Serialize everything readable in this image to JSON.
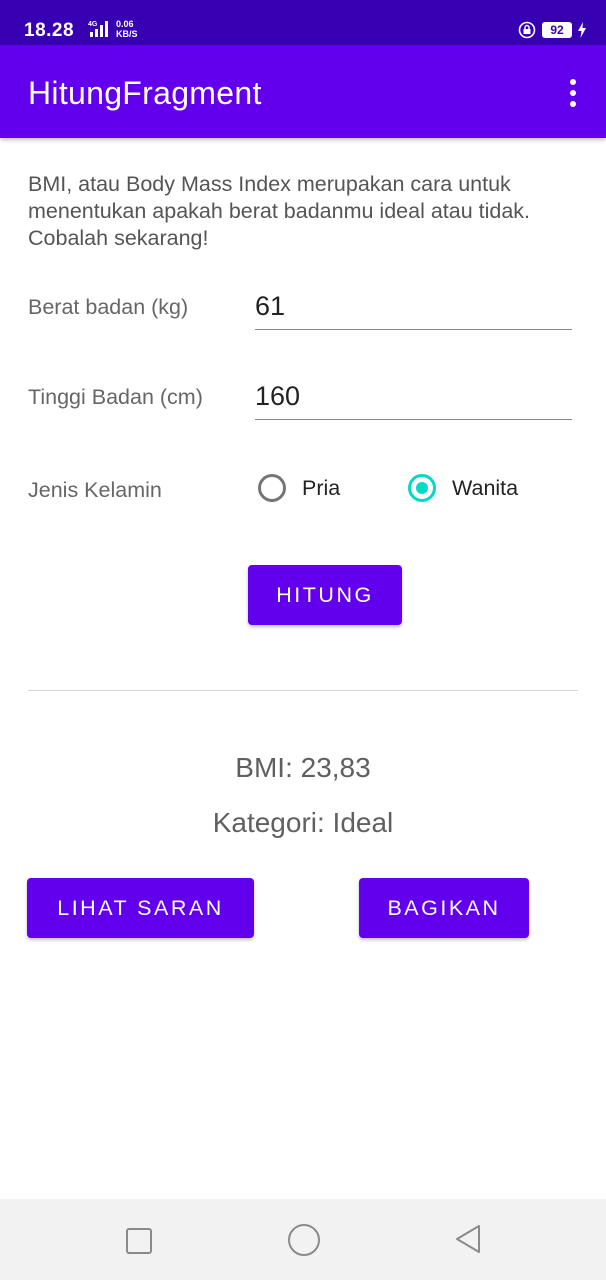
{
  "status_bar": {
    "time": "18.28",
    "network_type": "4G",
    "speed_value": "0.06",
    "speed_unit": "KB/S",
    "battery": "92",
    "icons": [
      "signal-icon",
      "lock-rotation-icon",
      "battery-icon",
      "charging-icon"
    ]
  },
  "app_bar": {
    "title": "HitungFragment",
    "overflow_icon": "more-vert-icon"
  },
  "intro_text": "BMI, atau Body Mass Index merupakan cara untuk menentukan apakah berat badanmu ideal atau tidak. Cobalah sekarang!",
  "form": {
    "weight_label": "Berat badan (kg)",
    "weight_value": "61",
    "height_label": "Tinggi Badan (cm)",
    "height_value": "160",
    "gender_label": "Jenis Kelamin",
    "gender_options": [
      {
        "label": "Pria",
        "selected": false
      },
      {
        "label": "Wanita",
        "selected": true
      }
    ]
  },
  "buttons": {
    "calculate": "HITUNG",
    "see_advice": "LIHAT SARAN",
    "share": "BAGIKAN"
  },
  "result": {
    "bmi": "BMI: 23,83",
    "category": "Kategori: Ideal"
  },
  "colors": {
    "status_bar": "#3700b3",
    "primary": "#6200ee",
    "accent": "#03dac5"
  },
  "nav_bar": {
    "icons": [
      "recents-square-icon",
      "home-circle-icon",
      "back-triangle-icon"
    ]
  }
}
